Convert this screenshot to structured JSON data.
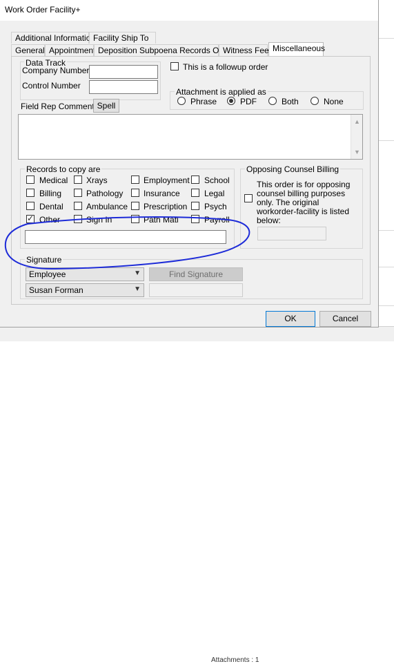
{
  "dialog": {
    "title": "Work Order Facility+",
    "tabs_row1": [
      "Additional Information",
      "Facility Ship To"
    ],
    "tabs_row2": [
      "General",
      "Appointment",
      "Deposition Subpoena Records Only",
      "Witness Fee",
      "Miscellaneous"
    ],
    "active_tab": "Miscellaneous"
  },
  "data_track": {
    "title": "Data Track",
    "company_number_label": "Company Number",
    "company_number_value": "",
    "control_number_label": "Control Number",
    "control_number_value": ""
  },
  "followup": {
    "label": "This is a followup order",
    "checked": false
  },
  "attachment": {
    "title": "Attachment is applied as",
    "options": [
      "Phrase",
      "PDF",
      "Both",
      "None"
    ],
    "selected": "PDF"
  },
  "field_rep": {
    "label": "Field Rep Comments",
    "spell_button": "Spell",
    "value": ""
  },
  "records": {
    "title": "Records to copy are",
    "items": [
      {
        "label": "Medical",
        "checked": false
      },
      {
        "label": "Xrays",
        "checked": false
      },
      {
        "label": "Employment",
        "checked": false
      },
      {
        "label": "School",
        "checked": false
      },
      {
        "label": "Billing",
        "checked": false
      },
      {
        "label": "Pathology",
        "checked": false
      },
      {
        "label": "Insurance",
        "checked": false
      },
      {
        "label": "Legal",
        "checked": false
      },
      {
        "label": "Dental",
        "checked": false
      },
      {
        "label": "Ambulance",
        "checked": false
      },
      {
        "label": "Prescription",
        "checked": false
      },
      {
        "label": "Psych",
        "checked": false
      },
      {
        "label": "Other",
        "checked": true
      },
      {
        "label": "Sign In",
        "checked": false
      },
      {
        "label": "Path Matl",
        "checked": false
      },
      {
        "label": "Payroll",
        "checked": false
      }
    ],
    "other_value": ""
  },
  "opposing": {
    "title": "Opposing Counsel Billing",
    "text": "This order is for opposing counsel billing purposes only. The original workorder-facility is listed below:",
    "checked": false,
    "value": ""
  },
  "signature": {
    "title": "Signature",
    "type_value": "Employee",
    "person_value": "Susan Forman",
    "find_button": "Find Signature",
    "value": ""
  },
  "buttons": {
    "ok": "OK",
    "cancel": "Cancel"
  },
  "background": {
    "attachments_text": "Attachments : 1"
  },
  "colors": {
    "annotation": "#1d2bd8",
    "accent": "#0078d7"
  }
}
